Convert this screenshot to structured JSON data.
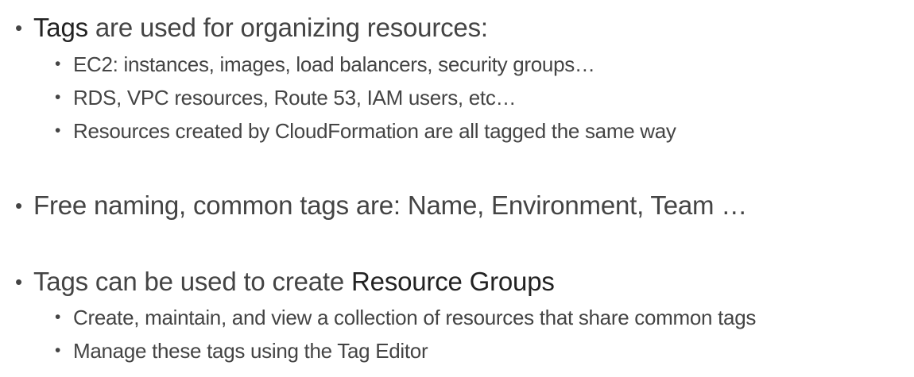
{
  "bullet_symbol": "•",
  "items": [
    {
      "prefix_em": "Tags",
      "text": " are used for organizing resources:",
      "subitems": [
        "EC2: instances, images, load balancers, security groups…",
        "RDS, VPC resources, Route 53, IAM users, etc…",
        "Resources created by CloudFormation are all tagged the same way"
      ]
    },
    {
      "text": "Free naming, common tags are: Name, Environment, Team …"
    },
    {
      "text": "Tags can be used to create ",
      "suffix_em": "Resource Groups",
      "subitems": [
        "Create, maintain, and view a collection of resources that share common tags",
        "Manage these tags using the Tag Editor"
      ]
    }
  ]
}
